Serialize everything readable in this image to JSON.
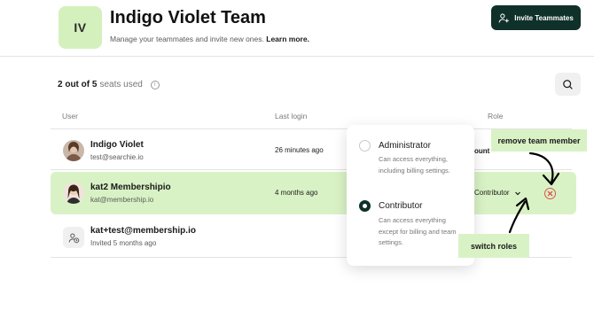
{
  "team": {
    "initials": "IV",
    "title": "Indigo Violet Team",
    "subtitle": "Manage your teammates and invite new ones.",
    "learn_more": "Learn more."
  },
  "invite_button": {
    "label": "Invite Teammates",
    "icon": "add-user-icon"
  },
  "seats": {
    "used_text": "2 out of 5",
    "suffix": "seats used",
    "icon": "info-icon"
  },
  "search": {
    "icon": "search-icon"
  },
  "table": {
    "headers": {
      "user": "User",
      "last_login": "Last login",
      "role": "Role"
    },
    "rows": [
      {
        "name": "Indigo Violet",
        "email": "test@searchie.io",
        "last_login": "26 minutes ago",
        "role": "ount"
      },
      {
        "name": "kat2 Membershipio",
        "email": "kat@membership.io",
        "last_login": "4 months ago",
        "role": "Contributor"
      },
      {
        "name": "kat+test@membership.io",
        "email": "Invited 5 months ago",
        "last_login": "",
        "role": ""
      }
    ]
  },
  "role_dropdown": {
    "options": [
      {
        "title": "Administrator",
        "description": "Can access everything, including billing settings.",
        "selected": false
      },
      {
        "title": "Contributor",
        "description": "Can access everything except for billing and team settings.",
        "selected": true
      }
    ]
  },
  "callouts": {
    "remove": "remove team member",
    "switch": "switch roles"
  },
  "colors": {
    "accent_green": "#d9f2c5",
    "button_dark": "#10302a",
    "danger": "#d9534f"
  }
}
